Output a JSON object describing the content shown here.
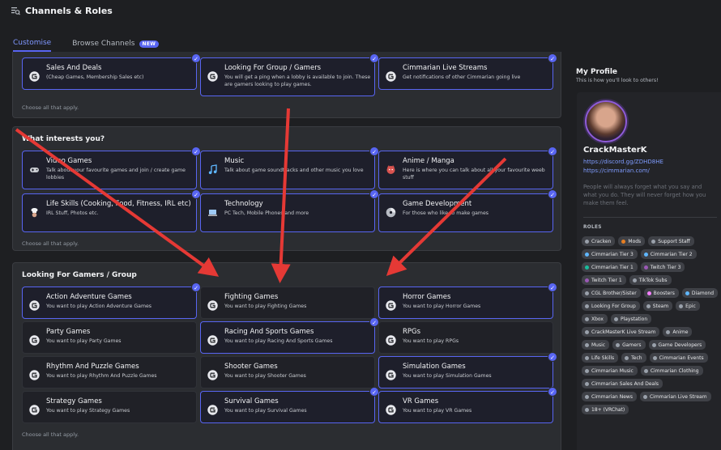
{
  "header": {
    "title": "Channels & Roles"
  },
  "tabs": [
    {
      "label": "Customise"
    },
    {
      "label": "Browse Channels",
      "badge": "NEW"
    }
  ],
  "sections": {
    "top": {
      "cards": [
        {
          "title": "Sales And Deals",
          "desc": "(Cheap Games, Membership Sales etc)",
          "icon": "server-logo-icon",
          "checked": true
        },
        {
          "title": "Looking For Group / Gamers",
          "desc": "You will get a ping when a lobby is available to join. These are gamers looking to play games.",
          "icon": "server-logo-icon",
          "checked": true
        },
        {
          "title": "Cimmarian Live Streams",
          "desc": "Get notifications of other Cimmarian going live",
          "icon": "server-logo-icon",
          "checked": true
        }
      ],
      "footer": "Choose all that apply."
    },
    "interests": {
      "title": "What interests you?",
      "cards": [
        {
          "title": "Video Games",
          "desc": "Talk about your favourite games and join / create game lobbies",
          "icon": "game-controller-icon",
          "checked": true
        },
        {
          "title": "Music",
          "desc": "Talk about game soundtracks and other music you love",
          "icon": "music-note-icon",
          "checked": true
        },
        {
          "title": "Anime / Manga",
          "desc": "Here is where you can talk about all your favourite weeb stuff",
          "icon": "anime-face-icon",
          "checked": true
        },
        {
          "title": "Life Skills (Cooking, Food, Fitness, IRL etc)",
          "desc": "IRL Stuff, Photos etc.",
          "icon": "chef-icon",
          "checked": true
        },
        {
          "title": "Technology",
          "desc": "PC Tech, Mobile Phones and more",
          "icon": "laptop-icon",
          "checked": true
        },
        {
          "title": "Game Development",
          "desc": "For those who like to make games",
          "icon": "disc-icon",
          "checked": true
        }
      ],
      "footer": "Choose all that apply."
    },
    "gamers": {
      "title": "Looking For Gamers / Group",
      "cards": [
        {
          "title": "Action Adventure Games",
          "desc": "You want to play Action Adventure Games",
          "checked": true
        },
        {
          "title": "Fighting Games",
          "desc": "You want to play Fighting Games",
          "checked": false
        },
        {
          "title": "Horror Games",
          "desc": "You want to play Horror Games",
          "checked": true
        },
        {
          "title": "Party Games",
          "desc": "You want to play Party Games",
          "checked": false
        },
        {
          "title": "Racing And Sports Games",
          "desc": "You want to play Racing And Sports Games",
          "checked": true
        },
        {
          "title": "RPGs",
          "desc": "You want to play RPGs",
          "checked": false
        },
        {
          "title": "Rhythm And Puzzle Games",
          "desc": "You want to play Rhythm And Puzzle Games",
          "checked": false
        },
        {
          "title": "Shooter Games",
          "desc": "You want to play Shooter Games",
          "checked": false
        },
        {
          "title": "Simulation Games",
          "desc": "You want to play Simulation Games",
          "checked": true
        },
        {
          "title": "Strategy Games",
          "desc": "You want to play Strategy Games",
          "checked": false
        },
        {
          "title": "Survival Games",
          "desc": "You want to play Survival Games",
          "checked": true
        },
        {
          "title": "VR Games",
          "desc": "You want to play VR Games",
          "checked": true
        }
      ],
      "footer": "Choose all that apply."
    }
  },
  "profile": {
    "heading": "My Profile",
    "subheading": "This is how you'll look to others!",
    "name": "CrackMasterK",
    "link1": "https://discord.gg/ZDHD8HE",
    "link2": "https://cimmarian.com/",
    "bio": "People will always forget what you say and what you do. They will never forget how you make them feel.",
    "roles_label": "ROLES",
    "roles": [
      {
        "name": "Cracken",
        "color": "#9aa1ab"
      },
      {
        "name": "Mods",
        "color": "#e67e22"
      },
      {
        "name": "Support Staff",
        "color": "#9aa1ab"
      },
      {
        "name": "Cimmarian Tier 3",
        "color": "#5fb7ff"
      },
      {
        "name": "Cimmarian Tier 2",
        "color": "#5fb7ff"
      },
      {
        "name": "Cimmarian Tier 1",
        "color": "#1abc9c"
      },
      {
        "name": "Twitch Tier 3",
        "color": "#9b59b6"
      },
      {
        "name": "Twitch Tier 1",
        "color": "#9b59b6"
      },
      {
        "name": "TikTok Subs",
        "color": "#9aa1ab"
      },
      {
        "name": "CGL Brother/Sister",
        "color": "#9aa1ab"
      },
      {
        "name": "Boosters",
        "color": "#f47fff"
      },
      {
        "name": "Diamond",
        "color": "#5fb7ff"
      },
      {
        "name": "Looking For Group",
        "color": "#9aa1ab"
      },
      {
        "name": "Steam",
        "color": "#9aa1ab"
      },
      {
        "name": "Epic",
        "color": "#9aa1ab"
      },
      {
        "name": "Xbox",
        "color": "#9aa1ab"
      },
      {
        "name": "Playstation",
        "color": "#9aa1ab"
      },
      {
        "name": "CrackMasterK Live Stream",
        "color": "#9aa1ab"
      },
      {
        "name": "Anime",
        "color": "#9aa1ab"
      },
      {
        "name": "Music",
        "color": "#9aa1ab"
      },
      {
        "name": "Gamers",
        "color": "#9aa1ab"
      },
      {
        "name": "Game Developers",
        "color": "#9aa1ab"
      },
      {
        "name": "Life Skills",
        "color": "#9aa1ab"
      },
      {
        "name": "Tech",
        "color": "#9aa1ab"
      },
      {
        "name": "Cimmarian Events",
        "color": "#9aa1ab"
      },
      {
        "name": "Cimmarian Music",
        "color": "#9aa1ab"
      },
      {
        "name": "Cimmarian Clothing",
        "color": "#9aa1ab"
      },
      {
        "name": "Cimmarian Sales And Deals",
        "color": "#9aa1ab"
      },
      {
        "name": "Cimmarian News",
        "color": "#9aa1ab"
      },
      {
        "name": "Cimmarian Live Stream",
        "color": "#9aa1ab"
      },
      {
        "name": "18+ (VRChat)",
        "color": "#9aa1ab"
      }
    ]
  },
  "colors": {
    "accent": "#5865f2",
    "arrow": "#e53935"
  }
}
